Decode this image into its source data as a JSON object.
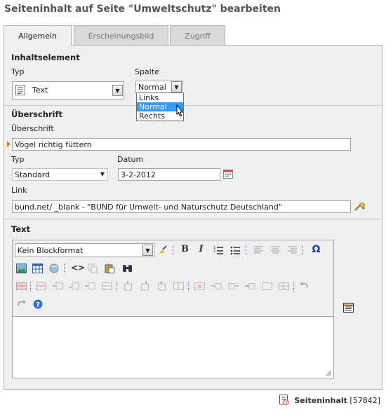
{
  "page_title": "Seiteninhalt auf Seite \"Umweltschutz\" bearbeiten",
  "tabs": [
    {
      "label": "Allgemein"
    },
    {
      "label": "Erscheinungsbild"
    },
    {
      "label": "Zugriff"
    }
  ],
  "content_element": {
    "heading": "Inhaltselement",
    "type_label": "Typ",
    "type_value": "Text",
    "column_label": "Spalte",
    "column_value": "Normal",
    "column_options": [
      "Links",
      "Normal",
      "Rechts"
    ]
  },
  "header": {
    "heading": "Überschrift",
    "header_label": "Überschrift",
    "header_value": "Vögel richtig füttern",
    "type_label": "Typ",
    "type_value": "Standard",
    "date_label": "Datum",
    "date_value": "3-2-2012",
    "link_label": "Link",
    "link_value": "bund.net/ _blank - \"BUND für Umwelt- und Naturschutz Deutschland\""
  },
  "text": {
    "heading": "Text",
    "blockformat": "Kein Blockformat"
  },
  "footer": {
    "label": "Seiteninhalt",
    "id": "[57842]"
  }
}
